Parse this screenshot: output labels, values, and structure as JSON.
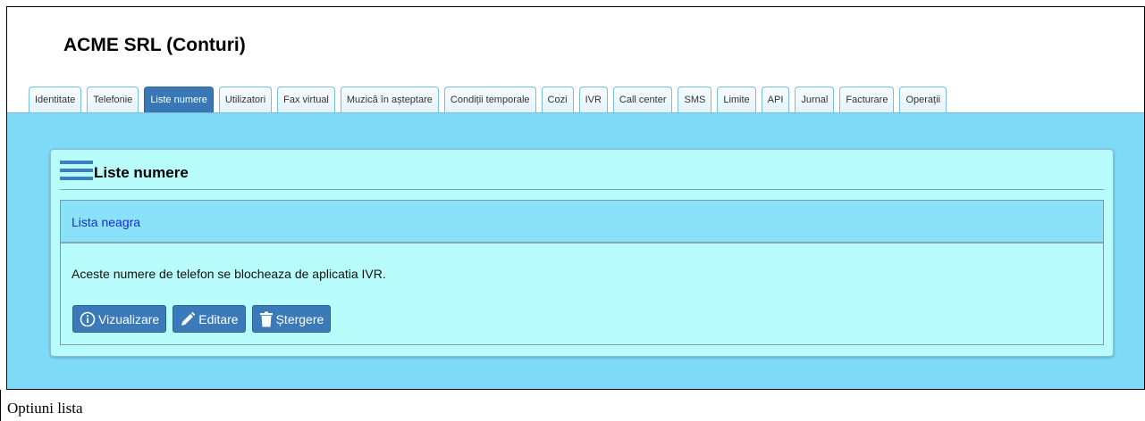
{
  "header": {
    "account_title": "ACME SRL (Conturi)"
  },
  "tabs": [
    {
      "label": "Identitate",
      "active": false
    },
    {
      "label": "Telefonie",
      "active": false
    },
    {
      "label": "Liste numere",
      "active": true
    },
    {
      "label": "Utilizatori",
      "active": false
    },
    {
      "label": "Fax virtual",
      "active": false
    },
    {
      "label": "Muzică în așteptare",
      "active": false
    },
    {
      "label": "Condiții temporale",
      "active": false
    },
    {
      "label": "Cozi",
      "active": false
    },
    {
      "label": "IVR",
      "active": false
    },
    {
      "label": "Call center",
      "active": false
    },
    {
      "label": "SMS",
      "active": false
    },
    {
      "label": "Limite",
      "active": false
    },
    {
      "label": "API",
      "active": false
    },
    {
      "label": "Jurnal",
      "active": false
    },
    {
      "label": "Facturare",
      "active": false
    },
    {
      "label": "Operații",
      "active": false
    }
  ],
  "panel": {
    "title": "Liste numere",
    "list": {
      "name": "Lista neagra",
      "description": "Aceste numere de telefon se blocheaza de aplicatia IVR.",
      "buttons": {
        "view": "Vizualizare",
        "edit": "Editare",
        "delete": "Ștergere"
      }
    }
  },
  "caption": "Optiuni lista",
  "colors": {
    "content_bg": "#7fdaf8",
    "panel_bg": "#b9fcfc",
    "accent": "#3a78b5",
    "link": "#1a2ad8"
  }
}
